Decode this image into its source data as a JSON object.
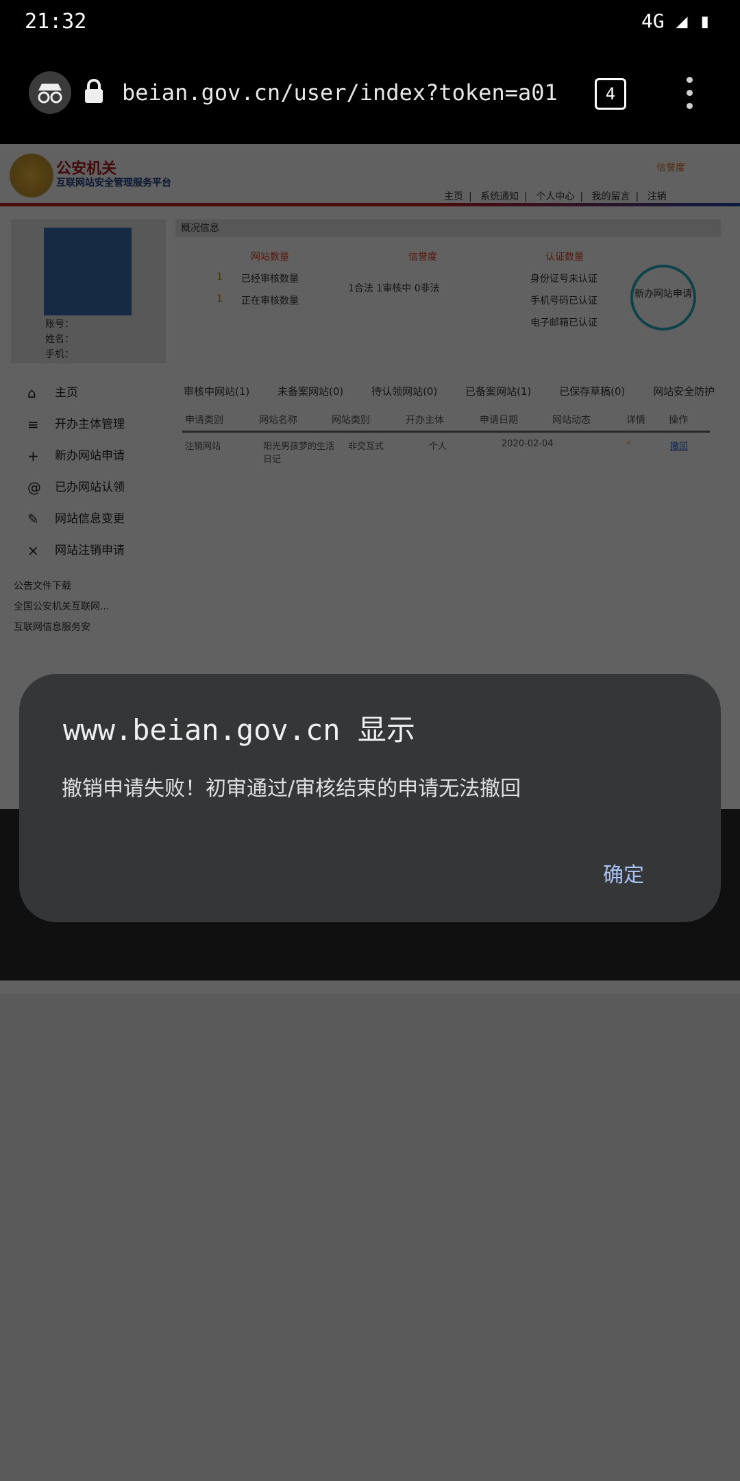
{
  "status_bar": {
    "time": "21:32",
    "network": "4G"
  },
  "browser": {
    "url": "beian.gov.cn/user/index?token=a01",
    "tab_count": "4"
  },
  "page": {
    "logo_title": "公安机关",
    "logo_subtitle": "互联网站安全管理服务平台",
    "credit_link": "信誉度",
    "nav": [
      "主页",
      "系统通知",
      "个人中心",
      "我的留言",
      "注销"
    ],
    "user_info": [
      "账号：",
      "姓名：",
      "手机："
    ],
    "overview_label": "概况信息",
    "stats": {
      "site_count_label": "网站数量",
      "audited": "已经审核数量",
      "auditing": "正在审核数量",
      "count_1": "1",
      "count_2": "1",
      "credit_label": "信誉度",
      "credit_text": "1合法  1审核中  0非法",
      "cert_label": "认证数量",
      "id_cert": "身份证号未认证",
      "phone_cert": "手机号码已认证",
      "email_cert": "电子邮箱已认证",
      "new_apply": "新办网站申请"
    },
    "side_menu": [
      "主页",
      "开办主体管理",
      "新办网站申请",
      "已办网站认领",
      "网站信息变更",
      "网站注销申请"
    ],
    "notice_title": "公告文件下载",
    "notices": [
      "全国公安机关互联网...",
      "互联网信息服务安"
    ],
    "tabs": [
      "审核中网站(1)",
      "未备案网站(0)",
      "待认领网站(0)",
      "已备案网站(1)",
      "已保存草稿(0)",
      "网站安全防护"
    ],
    "table_headers": [
      "申请类别",
      "网站名称",
      "网站类别",
      "开办主体",
      "申请日期",
      "网站动态",
      "详情",
      "操作"
    ],
    "table_row": [
      "注销网站",
      "阳光男孩梦的生活日记",
      "非交互式",
      "个人",
      "2020-02-04",
      "",
      "",
      "撤回"
    ]
  },
  "dialog": {
    "title": "www.beian.gov.cn 显示",
    "message": "撤销申请失败！初审通过/审核结束的申请无法撤回",
    "ok_label": "确定"
  }
}
